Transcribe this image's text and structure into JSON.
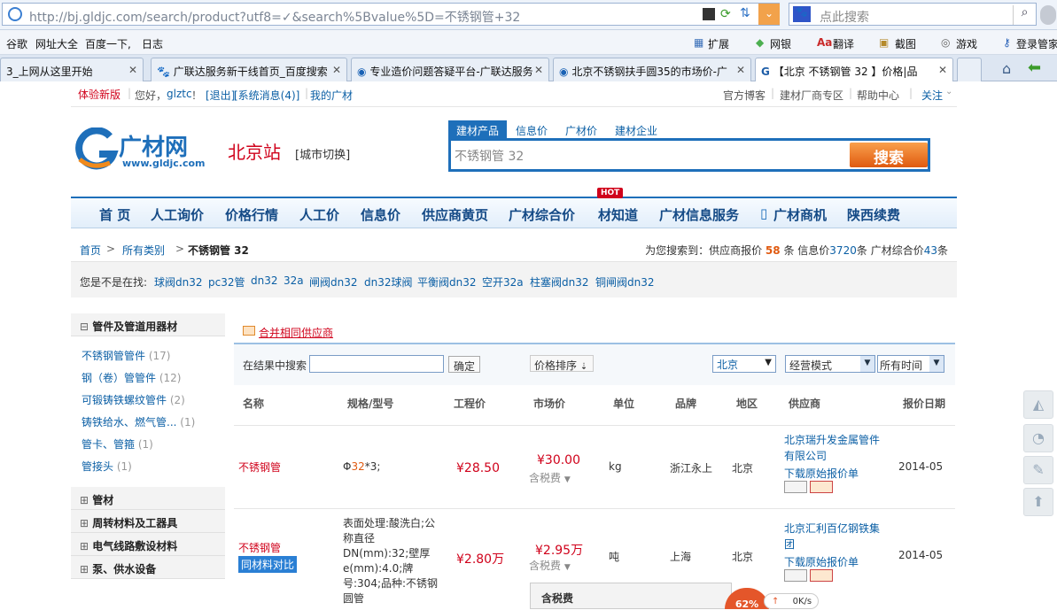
{
  "browser": {
    "url": "http://bj.gldjc.com/search/product?utf8=✓&search%5Bvalue%5D=不锈钢管+32",
    "search_placeholder": "点此搜索",
    "favorites": [
      "谷歌",
      "网址大全",
      "百度一下,",
      "日志"
    ],
    "toolbar_right": [
      "扩展",
      "网银",
      "翻译",
      "截图",
      "游戏",
      "登录管家"
    ],
    "tabs": [
      "3_上网从这里开始",
      "广联达服务新干线首页_百度搜索",
      "专业造价问题答疑平台-广联达服务",
      "北京不锈钢扶手圆35的市场价-广",
      "【北京 不锈钢管 32 】价格|品"
    ]
  },
  "topbar": {
    "try_new": "体验新版",
    "hello": "您好，",
    "user": "glztc",
    "exclaim": "！",
    "logout": "[退出]",
    "sysmsg": "[系统消息(4)]",
    "mycenter": "我的广材",
    "right_links": [
      "官方博客",
      "建材厂商专区",
      "帮助中心",
      "关注"
    ]
  },
  "header": {
    "logo_cn": "广材网",
    "logo_url": "www.gldjc.com",
    "station": "北京站",
    "switch_city": "[城市切换]",
    "search_tabs": [
      "建材产品",
      "信息价",
      "广材价",
      "建材企业"
    ],
    "search_value": "不锈钢管  32",
    "search_button": "搜索"
  },
  "nav": {
    "items": [
      "首 页",
      "人工询价",
      "价格行情",
      "人工价",
      "信息价",
      "供应商黄页",
      "广材综合价",
      "材知道",
      "广材信息服务",
      "广材商机",
      "陕西续费"
    ],
    "hot_badge": "HOT"
  },
  "breadcrumb": {
    "home": "首页",
    "all": "所有类别",
    "current": "不锈钢管 32",
    "summary_prefix": "为您搜索到：供应商报价",
    "supplier_count": "58",
    "unit1": "条",
    "info_label": "信息价",
    "info_count": "3720",
    "unit2": "条",
    "comp_label": "广材综合价",
    "comp_count": "43",
    "unit3": "条"
  },
  "suggest": {
    "label": "您是不是在找:",
    "terms": [
      "球阀dn32",
      "pc32管",
      "dn32",
      "32a",
      "闸阀dn32",
      "dn32球阀",
      "平衡阀dn32",
      "空开32a",
      "柱塞阀dn32",
      "铜闸阀dn32"
    ]
  },
  "sidebar": {
    "group1": "管件及管道用器材",
    "items": [
      {
        "name": "不锈钢管管件",
        "count": "(17)"
      },
      {
        "name": "钢（卷）管管件",
        "count": "(12)"
      },
      {
        "name": "可锻铸铁螺纹管件",
        "count": "(2)"
      },
      {
        "name": "铸铁给水、燃气管...",
        "count": "(1)"
      },
      {
        "name": "管卡、管箍",
        "count": "(1)"
      },
      {
        "name": "管接头",
        "count": "(1)"
      }
    ],
    "groups": [
      "管材",
      "周转材料及工器具",
      "电气线路敷设材料",
      "泵、供水设备"
    ]
  },
  "results": {
    "merge_label": "合并相同供应商",
    "filter_label": "在结果中搜索",
    "confirm": "确定",
    "price_sort": "价格排序",
    "region_select": "北京",
    "mode_select": "经营模式",
    "time_select": "所有时间",
    "columns": [
      "名称",
      "规格/型号",
      "工程价",
      "市场价",
      "单位",
      "品牌",
      "地区",
      "供应商",
      "报价日期"
    ],
    "rows": [
      {
        "name": "不锈钢管",
        "spec": "Φ32*3;",
        "eng_price": "¥28.50",
        "market_price": "¥30.00",
        "tax": "含税费",
        "unit": "kg",
        "brand": "浙江永上",
        "region": "北京",
        "supplier": "北京瑞升发金属管件有限公司",
        "download": "下载原始报价单",
        "date": "2014-05"
      },
      {
        "name": "不锈钢管",
        "compare": "同材料对比",
        "spec": "表面处理:酸洗白;公称直径DN(mm):32;壁厚e(mm):4.0;牌号:304;品种:不锈钢圆管",
        "eng_price": "¥2.80万",
        "market_price": "¥2.95万",
        "tax": "含税费",
        "unit": "吨",
        "brand": "上海",
        "region": "北京",
        "supplier": "北京汇利百亿钢铁集团",
        "download": "下载原始报价单",
        "date": "2014-05"
      }
    ],
    "tax_popup": "含税费"
  },
  "widget": {
    "percent": "62%",
    "speed": "0K/s"
  }
}
